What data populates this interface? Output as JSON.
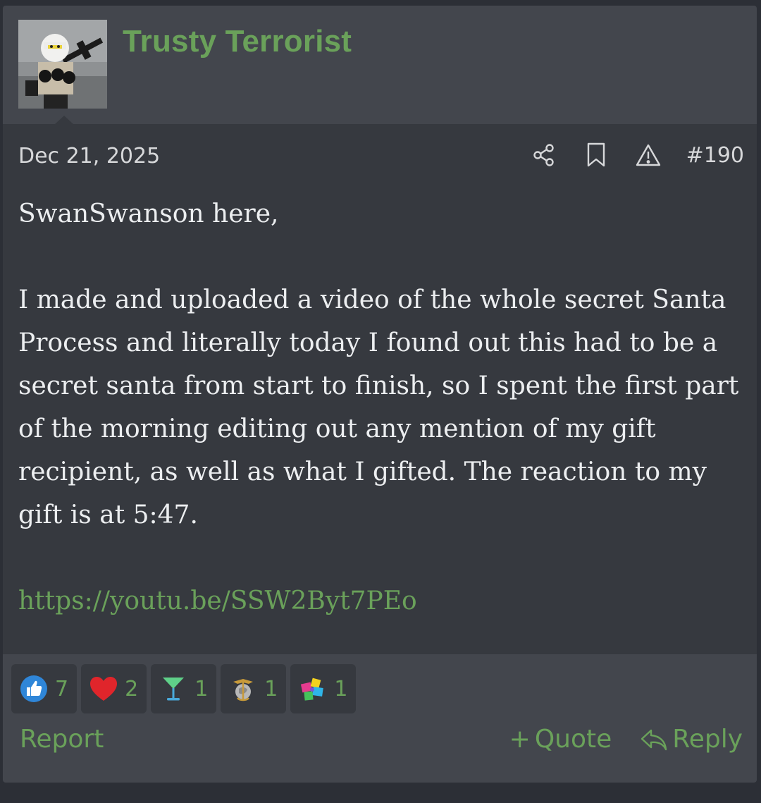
{
  "post": {
    "author": "Trusty Terrorist",
    "date": "Dec 21, 2025",
    "post_number": "#190",
    "icons": [
      "share-icon",
      "bookmark-icon",
      "warning-icon"
    ],
    "body_lines": [
      "SwanSwanson here,",
      "I made and uploaded a video of the whole secret Santa Process and literally today I found out this had to be a secret santa from start to finish, so I spent the first part of the morning editing out any mention of my gift recipient, as well as what I gifted. The reaction to my gift is at 5:47."
    ],
    "link": "https://youtu.be/SSW2Byt7PEo"
  },
  "reactions": [
    {
      "icon": "like-icon",
      "count": "7"
    },
    {
      "icon": "heart-icon",
      "count": "2"
    },
    {
      "icon": "cocktail-icon",
      "count": "1"
    },
    {
      "icon": "marine-emblem-icon",
      "count": "1"
    },
    {
      "icon": "puzzle-icon",
      "count": "1"
    }
  ],
  "actions": {
    "report": "Report",
    "quote": "Quote",
    "reply": "Reply"
  },
  "colors": {
    "accent": "#6aa15a",
    "background": "#36393f",
    "header": "#43464d"
  }
}
